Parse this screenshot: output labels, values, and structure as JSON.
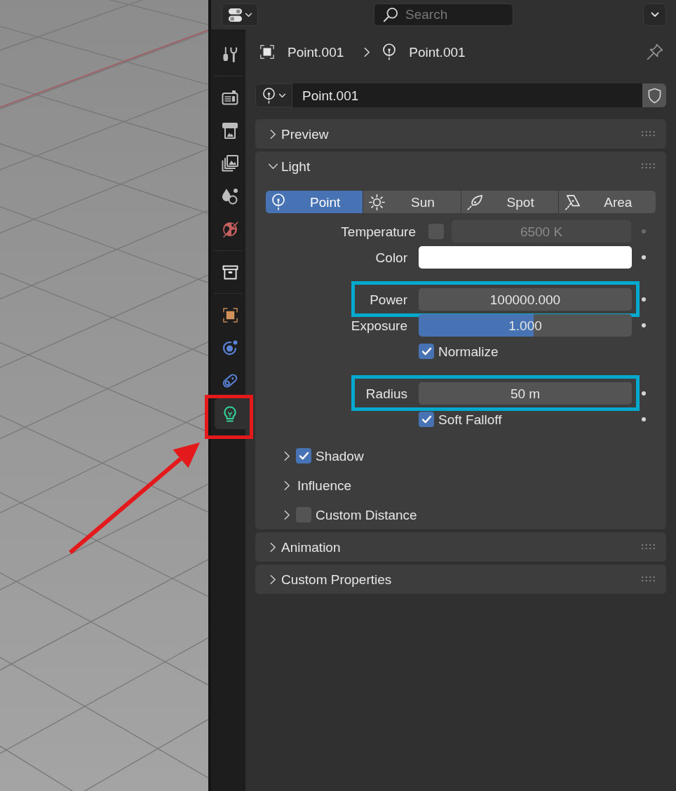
{
  "header": {
    "search": {
      "placeholder": "Search"
    }
  },
  "sidebar": {
    "groups": [
      {
        "tabs": [
          {
            "kind": "tool",
            "selected": false,
            "highlighted": false
          }
        ]
      },
      {
        "tabs": [
          {
            "kind": "render",
            "selected": false,
            "highlighted": false
          },
          {
            "kind": "output",
            "selected": false,
            "highlighted": false
          },
          {
            "kind": "view_layer",
            "selected": false,
            "highlighted": false
          },
          {
            "kind": "scene",
            "selected": false,
            "highlighted": false
          },
          {
            "kind": "world",
            "selected": false,
            "highlighted": false
          }
        ]
      },
      {
        "tabs": [
          {
            "kind": "collection",
            "selected": false,
            "highlighted": false
          }
        ]
      },
      {
        "tabs": [
          {
            "kind": "object",
            "selected": false,
            "highlighted": false
          },
          {
            "kind": "physics",
            "selected": false,
            "highlighted": false
          },
          {
            "kind": "constraints",
            "selected": false,
            "highlighted": false
          },
          {
            "kind": "data",
            "selected": true,
            "highlighted": true
          }
        ]
      }
    ]
  },
  "breadcrumb": [
    {
      "kind": "object",
      "label": "Point.001"
    },
    {
      "kind": "light",
      "label": "Point.001"
    }
  ],
  "datablock": {
    "name": "Point.001"
  },
  "panels": [
    {
      "title": "Preview",
      "expanded": false
    },
    {
      "title": "Light",
      "expanded": true,
      "light_types": [
        {
          "kind": "point",
          "label": "Point",
          "selected": true
        },
        {
          "kind": "sun",
          "label": "Sun",
          "selected": false
        },
        {
          "kind": "spot",
          "label": "Spot",
          "selected": false
        },
        {
          "kind": "area",
          "label": "Area",
          "selected": false
        }
      ],
      "property_groups": [
        {
          "rows": [
            {
              "kind": "number",
              "label": "Temperature",
              "value": "6500 K",
              "toggle": {
                "checked": false
              },
              "disabled": true,
              "animatable": true,
              "highlighted": false
            },
            {
              "kind": "color",
              "label": "Color",
              "color": "#ffffff",
              "disabled": false,
              "animatable": true,
              "highlighted": false
            }
          ]
        },
        {
          "rows": [
            {
              "kind": "number",
              "label": "Power",
              "value": "100000.000",
              "disabled": false,
              "animatable": true,
              "highlighted": true
            },
            {
              "kind": "slider",
              "label": "Exposure",
              "value": "1.000",
              "level": 0.54,
              "disabled": false,
              "animatable": true,
              "highlighted": false
            },
            {
              "kind": "checkbox",
              "label": "Normalize",
              "checked": true,
              "disabled": false,
              "animatable": false,
              "highlighted": false
            }
          ]
        },
        {
          "rows": [
            {
              "kind": "number",
              "label": "Radius",
              "value": "50 m",
              "disabled": false,
              "animatable": true,
              "highlighted": true
            },
            {
              "kind": "checkbox",
              "label": "Soft Falloff",
              "checked": true,
              "disabled": false,
              "animatable": true,
              "highlighted": false
            }
          ]
        }
      ],
      "subpanels": [
        {
          "label": "Shadow",
          "expanded": false,
          "checkbox": {
            "checked": true
          }
        },
        {
          "label": "Influence",
          "expanded": false
        },
        {
          "label": "Custom Distance",
          "expanded": false,
          "checkbox": {
            "checked": false
          }
        }
      ]
    },
    {
      "title": "Animation",
      "expanded": false
    },
    {
      "title": "Custom Properties",
      "expanded": false
    }
  ]
}
